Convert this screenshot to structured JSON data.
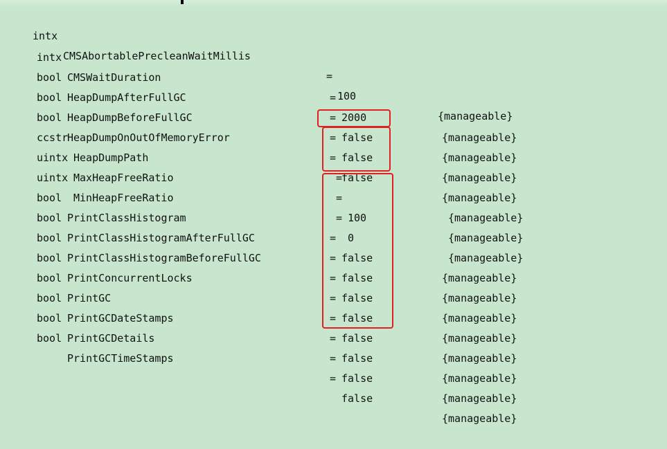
{
  "flags": [
    {
      "type": "intx",
      "name": "CMSAbortablePrecleanWaitMillis",
      "eq": "=",
      "value": "100",
      "flag": "{manageable}"
    },
    {
      "type": "intx",
      "name": "CMSWaitDuration",
      "eq": "=",
      "value": "2000",
      "flag": "{manageable}"
    },
    {
      "type": "bool",
      "name": "HeapDumpAfterFullGC",
      "eq": "=",
      "value": "false",
      "flag": "{manageable}"
    },
    {
      "type": "bool",
      "name": "HeapDumpBeforeFullGC",
      "eq": "=",
      "value": "false",
      "flag": "{manageable}"
    },
    {
      "type": "bool",
      "name": "HeapDumpOnOutOfMemoryError",
      "eq": "=",
      "value": "false",
      "flag": "{manageable}"
    },
    {
      "type": "ccstr",
      "name": "HeapDumpPath",
      "eq": "=",
      "value": "",
      "flag": "{manageable}"
    },
    {
      "type": "uintx",
      "name": "MaxHeapFreeRatio",
      "eq": "=",
      "value": "100",
      "flag": "{manageable}"
    },
    {
      "type": "uintx",
      "name": "MinHeapFreeRatio",
      "eq": "=",
      "value": "0",
      "flag": "{manageable}"
    },
    {
      "type": "bool",
      "name": "PrintClassHistogram",
      "eq": "=",
      "value": "false",
      "flag": "{manageable}"
    },
    {
      "type": "bool",
      "name": "PrintClassHistogramAfterFullGC",
      "eq": "=",
      "value": "false",
      "flag": "{manageable}"
    },
    {
      "type": "bool",
      "name": "PrintClassHistogramBeforeFullGC",
      "eq": "=",
      "value": "false",
      "flag": "{manageable}"
    },
    {
      "type": "bool",
      "name": "PrintConcurrentLocks",
      "eq": "=",
      "value": "false",
      "flag": "{manageable}"
    },
    {
      "type": "bool",
      "name": "PrintGC",
      "eq": "=",
      "value": "false",
      "flag": "{manageable}"
    },
    {
      "type": "bool",
      "name": "PrintGCDateStamps",
      "eq": "=",
      "value": "false",
      "flag": "{manageable}"
    },
    {
      "type": "bool",
      "name": "PrintGCDetails",
      "eq": "=",
      "value": "false",
      "flag": "{manageable}"
    },
    {
      "type": "bool",
      "name": "PrintGCTimeStamps",
      "eq": "=",
      "value": "false",
      "flag": "{manageable}"
    }
  ],
  "colors": {
    "background": "#c7e6cd",
    "text": "#111111",
    "highlight": "#e02020"
  }
}
